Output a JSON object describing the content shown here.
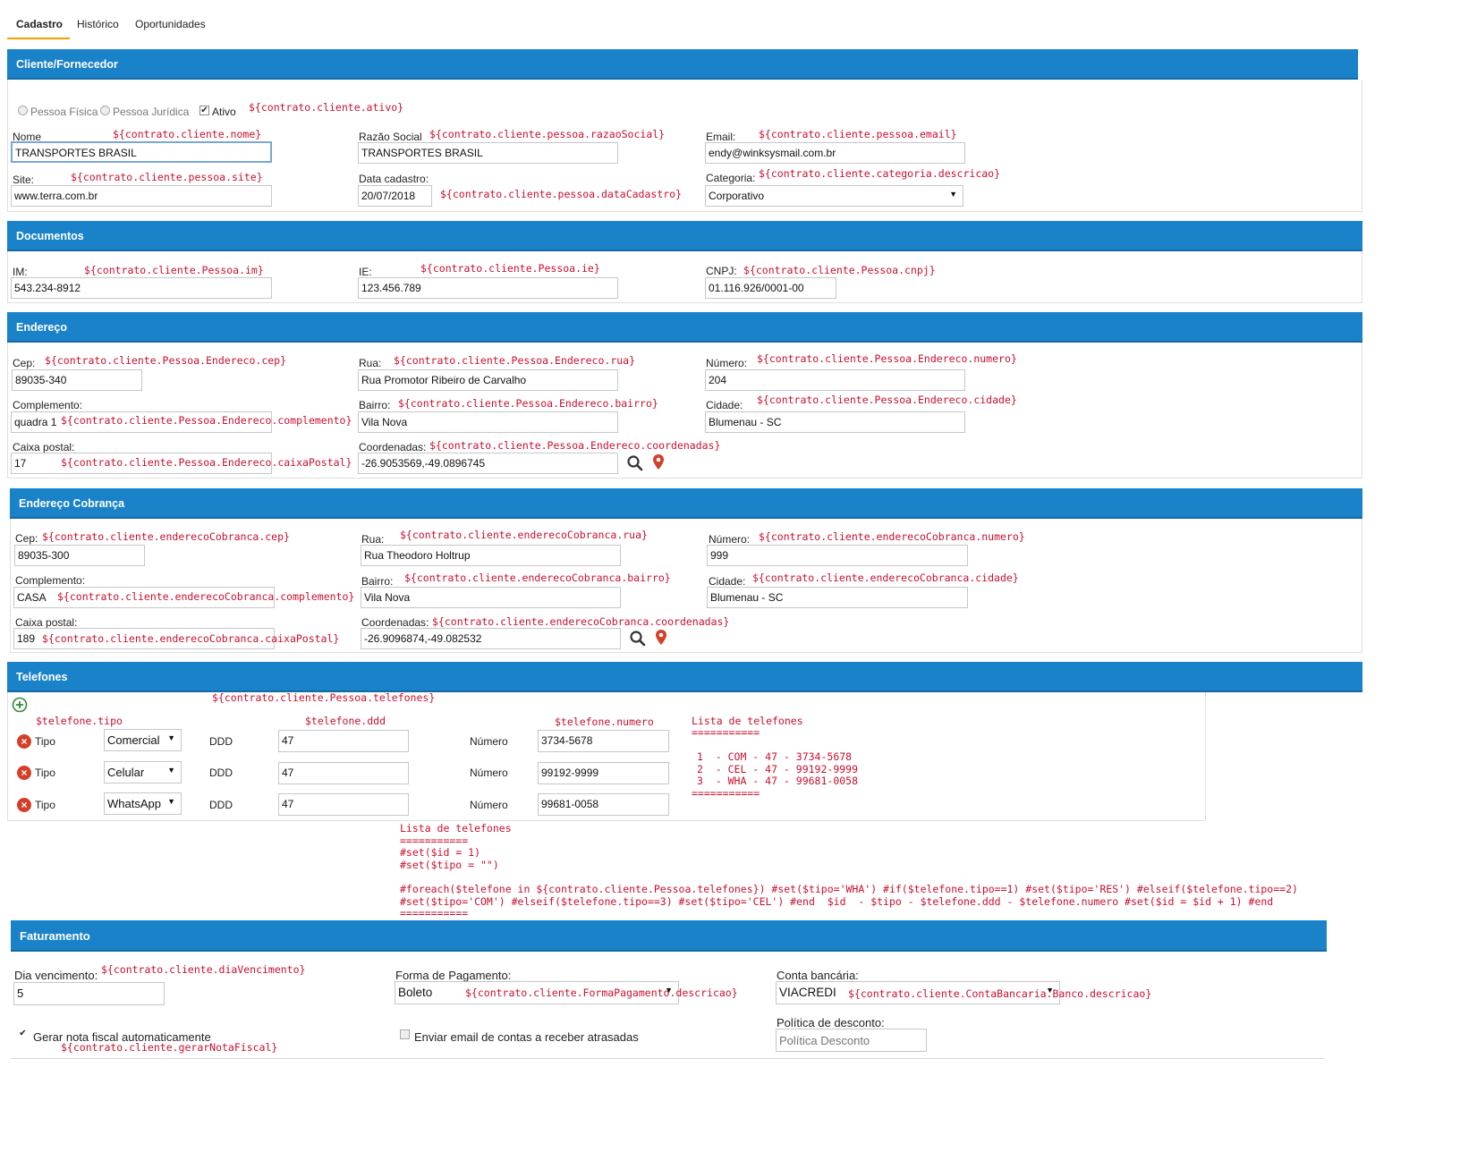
{
  "tabs": [
    "Cadastro",
    "Histórico",
    "Oportunidades"
  ],
  "cliente": {
    "header": "Cliente/Fornecedor",
    "pessoa_fisica": "Pessoa Física",
    "pessoa_juridica": "Pessoa Jurídica",
    "ativo": "Ativo",
    "ativo_tpl": "${contrato.cliente.ativo}",
    "nome_label": "Nome",
    "nome_tpl": "${contrato.cliente.nome}",
    "nome_value": "TRANSPORTES BRASIL",
    "razao_label": "Razão Social",
    "razao_tpl": "${contrato.cliente.pessoa.razaoSocial}",
    "razao_value": "TRANSPORTES BRASIL",
    "email_label": "Email:",
    "email_tpl": "${contrato.cliente.pessoa.email}",
    "email_value": "endy@winksysmail.com.br",
    "site_label": "Site:",
    "site_tpl": "${contrato.cliente.pessoa.site}",
    "site_value": "www.terra.com.br",
    "data_label": "Data cadastro:",
    "data_value": "20/07/2018",
    "data_tpl": "${contrato.cliente.pessoa.dataCadastro}",
    "categoria_label": "Categoria:",
    "categoria_tpl": "${contrato.cliente.categoria.descricao}",
    "categoria_value": "Corporativo"
  },
  "documentos": {
    "header": "Documentos",
    "im_label": "IM:",
    "im_tpl": "${contrato.cliente.Pessoa.im}",
    "im_value": "543.234-8912",
    "ie_label": "IE:",
    "ie_tpl": "${contrato.cliente.Pessoa.ie}",
    "ie_value": "123.456.789",
    "cnpj_label": "CNPJ:",
    "cnpj_tpl": "${contrato.cliente.Pessoa.cnpj}",
    "cnpj_value": "01.116.926/0001-00"
  },
  "endereco": {
    "header": "Endereço",
    "cep_label": "Cep:",
    "cep_tpl": "${contrato.cliente.Pessoa.Endereco.cep}",
    "cep_value": "89035-340",
    "rua_label": "Rua:",
    "rua_tpl": "${contrato.cliente.Pessoa.Endereco.rua}",
    "rua_value": "Rua Promotor Ribeiro de Carvalho",
    "numero_label": "Número:",
    "numero_tpl": "${contrato.cliente.Pessoa.Endereco.numero}",
    "numero_value": "204",
    "compl_label": "Complemento:",
    "compl_value": "quadra 1",
    "compl_tpl": "${contrato.cliente.Pessoa.Endereco.complemento}",
    "bairro_label": "Bairro:",
    "bairro_tpl": "${contrato.cliente.Pessoa.Endereco.bairro}",
    "bairro_value": "Vila Nova",
    "cidade_label": "Cidade:",
    "cidade_tpl": "${contrato.cliente.Pessoa.Endereco.cidade}",
    "cidade_value": "Blumenau - SC",
    "caixa_label": "Caixa postal:",
    "caixa_value": "17",
    "caixa_tpl": "${contrato.cliente.Pessoa.Endereco.caixaPostal}",
    "coord_label": "Coordenadas:",
    "coord_tpl": "${contrato.cliente.Pessoa.Endereco.coordenadas}",
    "coord_value": "-26.9053569,-49.0896745"
  },
  "cobranca": {
    "header": "Endereço Cobrança",
    "cep_label": "Cep:",
    "cep_tpl": "${contrato.cliente.enderecoCobranca.cep}",
    "cep_value": "89035-300",
    "rua_label": "Rua:",
    "rua_tpl": "${contrato.cliente.enderecoCobranca.rua}",
    "rua_value": "Rua Theodoro Holtrup",
    "numero_label": "Número:",
    "numero_tpl": "${contrato.cliente.enderecoCobranca.numero}",
    "numero_value": "999",
    "compl_label": "Complemento:",
    "compl_value": "CASA",
    "compl_tpl": "${contrato.cliente.enderecoCobranca.complemento}",
    "bairro_label": "Bairro:",
    "bairro_tpl": "${contrato.cliente.enderecoCobranca.bairro}",
    "bairro_value": "Vila Nova",
    "cidade_label": "Cidade:",
    "cidade_tpl": "${contrato.cliente.enderecoCobranca.cidade}",
    "cidade_value": "Blumenau - SC",
    "caixa_label": "Caixa postal:",
    "caixa_value": "189",
    "caixa_tpl": "${contrato.cliente.enderecoCobranca.caixaPostal}",
    "coord_label": "Coordenadas:",
    "coord_tpl": "${contrato.cliente.enderecoCobranca.coordenadas}",
    "coord_value": "-26.9096874,-49.082532"
  },
  "telefones": {
    "header": "Telefones",
    "list_tpl": "${contrato.cliente.Pessoa.telefones}",
    "tipo_tpl": "$telefone.tipo",
    "ddd_tpl": "$telefone.ddd",
    "numero_tpl": "$telefone.numero",
    "tipo_label": "Tipo",
    "ddd_label": "DDD",
    "numero_label": "Número",
    "rows": [
      {
        "tipo": "Comercial",
        "ddd": "47",
        "numero": "3734-5678"
      },
      {
        "tipo": "Celular",
        "ddd": "47",
        "numero": "99192-9999"
      },
      {
        "tipo": "WhatsApp",
        "ddd": "47",
        "numero": "99681-0058"
      }
    ],
    "lista_title": "Lista de telefones",
    "lista_sep": "===========",
    "lista_lines": [
      "1  - COM - 47 - 3734-5678",
      "2  - CEL - 47 - 99192-9999",
      "3  - WHA - 47 - 99681-0058"
    ]
  },
  "template_block": {
    "title": "Lista de telefones",
    "sep": "===========",
    "line1": "#set($id = 1)",
    "line2": "#set($tipo = \"\")",
    "line3": "#foreach($telefone in ${contrato.cliente.Pessoa.telefones}) #set($tipo='WHA') #if($telefone.tipo==1) #set($tipo='RES') #elseif($telefone.tipo==2)",
    "line4": "#set($tipo='COM') #elseif($telefone.tipo==3) #set($tipo='CEL') #end  $id  - $tipo - $telefone.ddd - $telefone.numero #set($id = $id + 1) #end"
  },
  "faturamento": {
    "header": "Faturamento",
    "dia_label": "Dia vencimento:",
    "dia_tpl": "${contrato.cliente.diaVencimento}",
    "dia_value": "5",
    "forma_label": "Forma de Pagamento:",
    "forma_value": "Boleto",
    "forma_tpl": "${contrato.cliente.FormaPagamento.descricao}",
    "conta_label": "Conta bancária:",
    "conta_value": "VIACREDI",
    "conta_tpl": "${contrato.cliente.ContaBancaria.Banco.descricao}",
    "gerar_label": "Gerar nota fiscal automaticamente",
    "gerar_tpl": "${contrato.cliente.gerarNotaFiscal}",
    "enviar_label": "Enviar email de contas a receber atrasadas",
    "politica_label": "Política de desconto:",
    "politica_placeholder": "Política Desconto"
  },
  "colors": {
    "header_blue": "#1a82c9",
    "template_red": "#c8102e",
    "tab_active": "#f0a000"
  }
}
